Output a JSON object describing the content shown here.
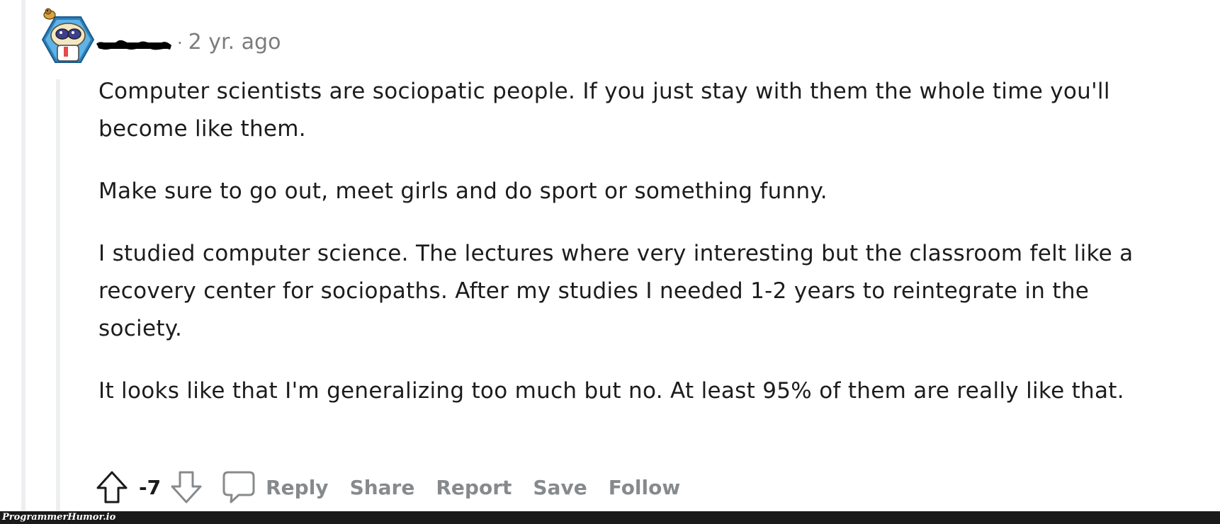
{
  "comment": {
    "timestamp": "2 yr. ago",
    "separator": "·",
    "paragraphs": [
      "Computer scientists are sociopatic people. If you just stay with them the whole time you'll become like them.",
      "Make sure to go out, meet girls and do sport or something funny.",
      "I studied computer science. The lectures where very interesting but the classroom felt like a recovery center for sociopaths. After my studies I needed 1-2 years to reintegrate in the society.",
      "It looks like that I'm generalizing too much but no. At least 95% of them are really like that."
    ],
    "vote_count": "-7"
  },
  "actions": {
    "reply_label": "Reply",
    "share_label": "Share",
    "report_label": "Report",
    "save_label": "Save",
    "follow_label": "Follow"
  },
  "icons": {
    "upvote": "arrow-up-outline-icon",
    "downvote": "arrow-down-outline-icon",
    "reply": "speech-bubble-icon"
  },
  "colors": {
    "text": "#1c1c1c",
    "muted": "#878a8c",
    "thread_line": "#edeff1",
    "watermark_bar": "#1a1a1a"
  },
  "watermark": {
    "text": "ProgrammerHumor.io"
  }
}
